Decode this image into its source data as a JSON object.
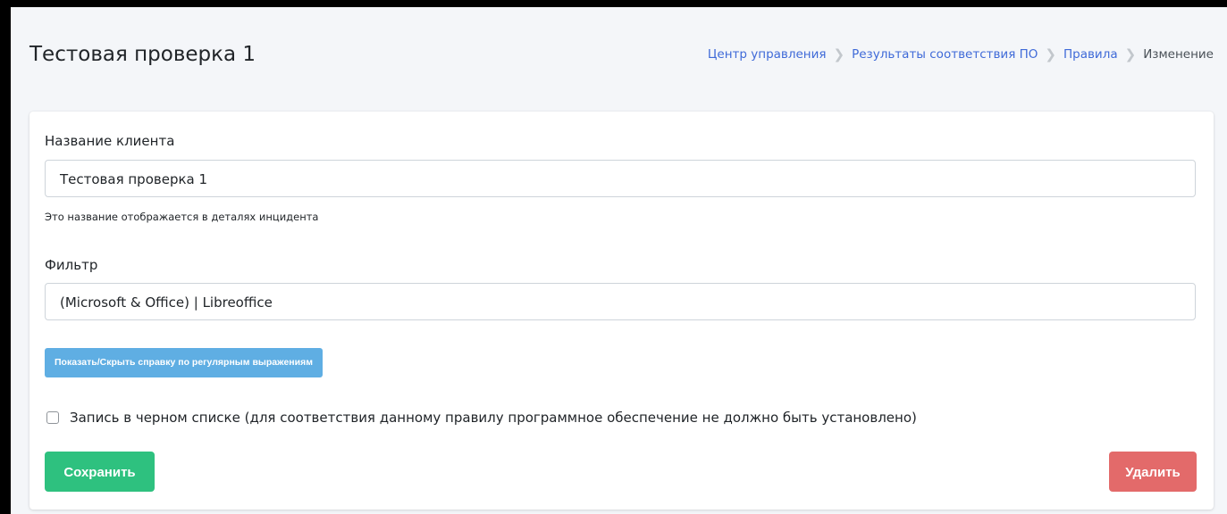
{
  "header": {
    "title": "Тестовая проверка 1",
    "breadcrumb": [
      {
        "label": "Центр управления"
      },
      {
        "label": "Результаты соответствия ПО"
      },
      {
        "label": "Правила"
      },
      {
        "label": "Изменение"
      }
    ]
  },
  "form": {
    "client_name": {
      "label": "Название клиента",
      "value": "Тестовая проверка 1",
      "help": "Это название отображается в деталях инцидента"
    },
    "filter": {
      "label": "Фильтр",
      "value": "(Microsoft & Office) | Libreoffice"
    },
    "regex_help_button": "Показать/Скрыть справку по регулярным выражениям",
    "blacklist": {
      "checked": false,
      "label": "Запись в черном списке (для соответствия данному правилу программное обеспечение не должно быть установлено)"
    },
    "save_button": "Сохранить",
    "delete_button": "Удалить"
  },
  "colors": {
    "link": "#3f6ad8",
    "save": "#2ec17f",
    "delete": "#e36a6a",
    "info_button": "#5faee3"
  }
}
